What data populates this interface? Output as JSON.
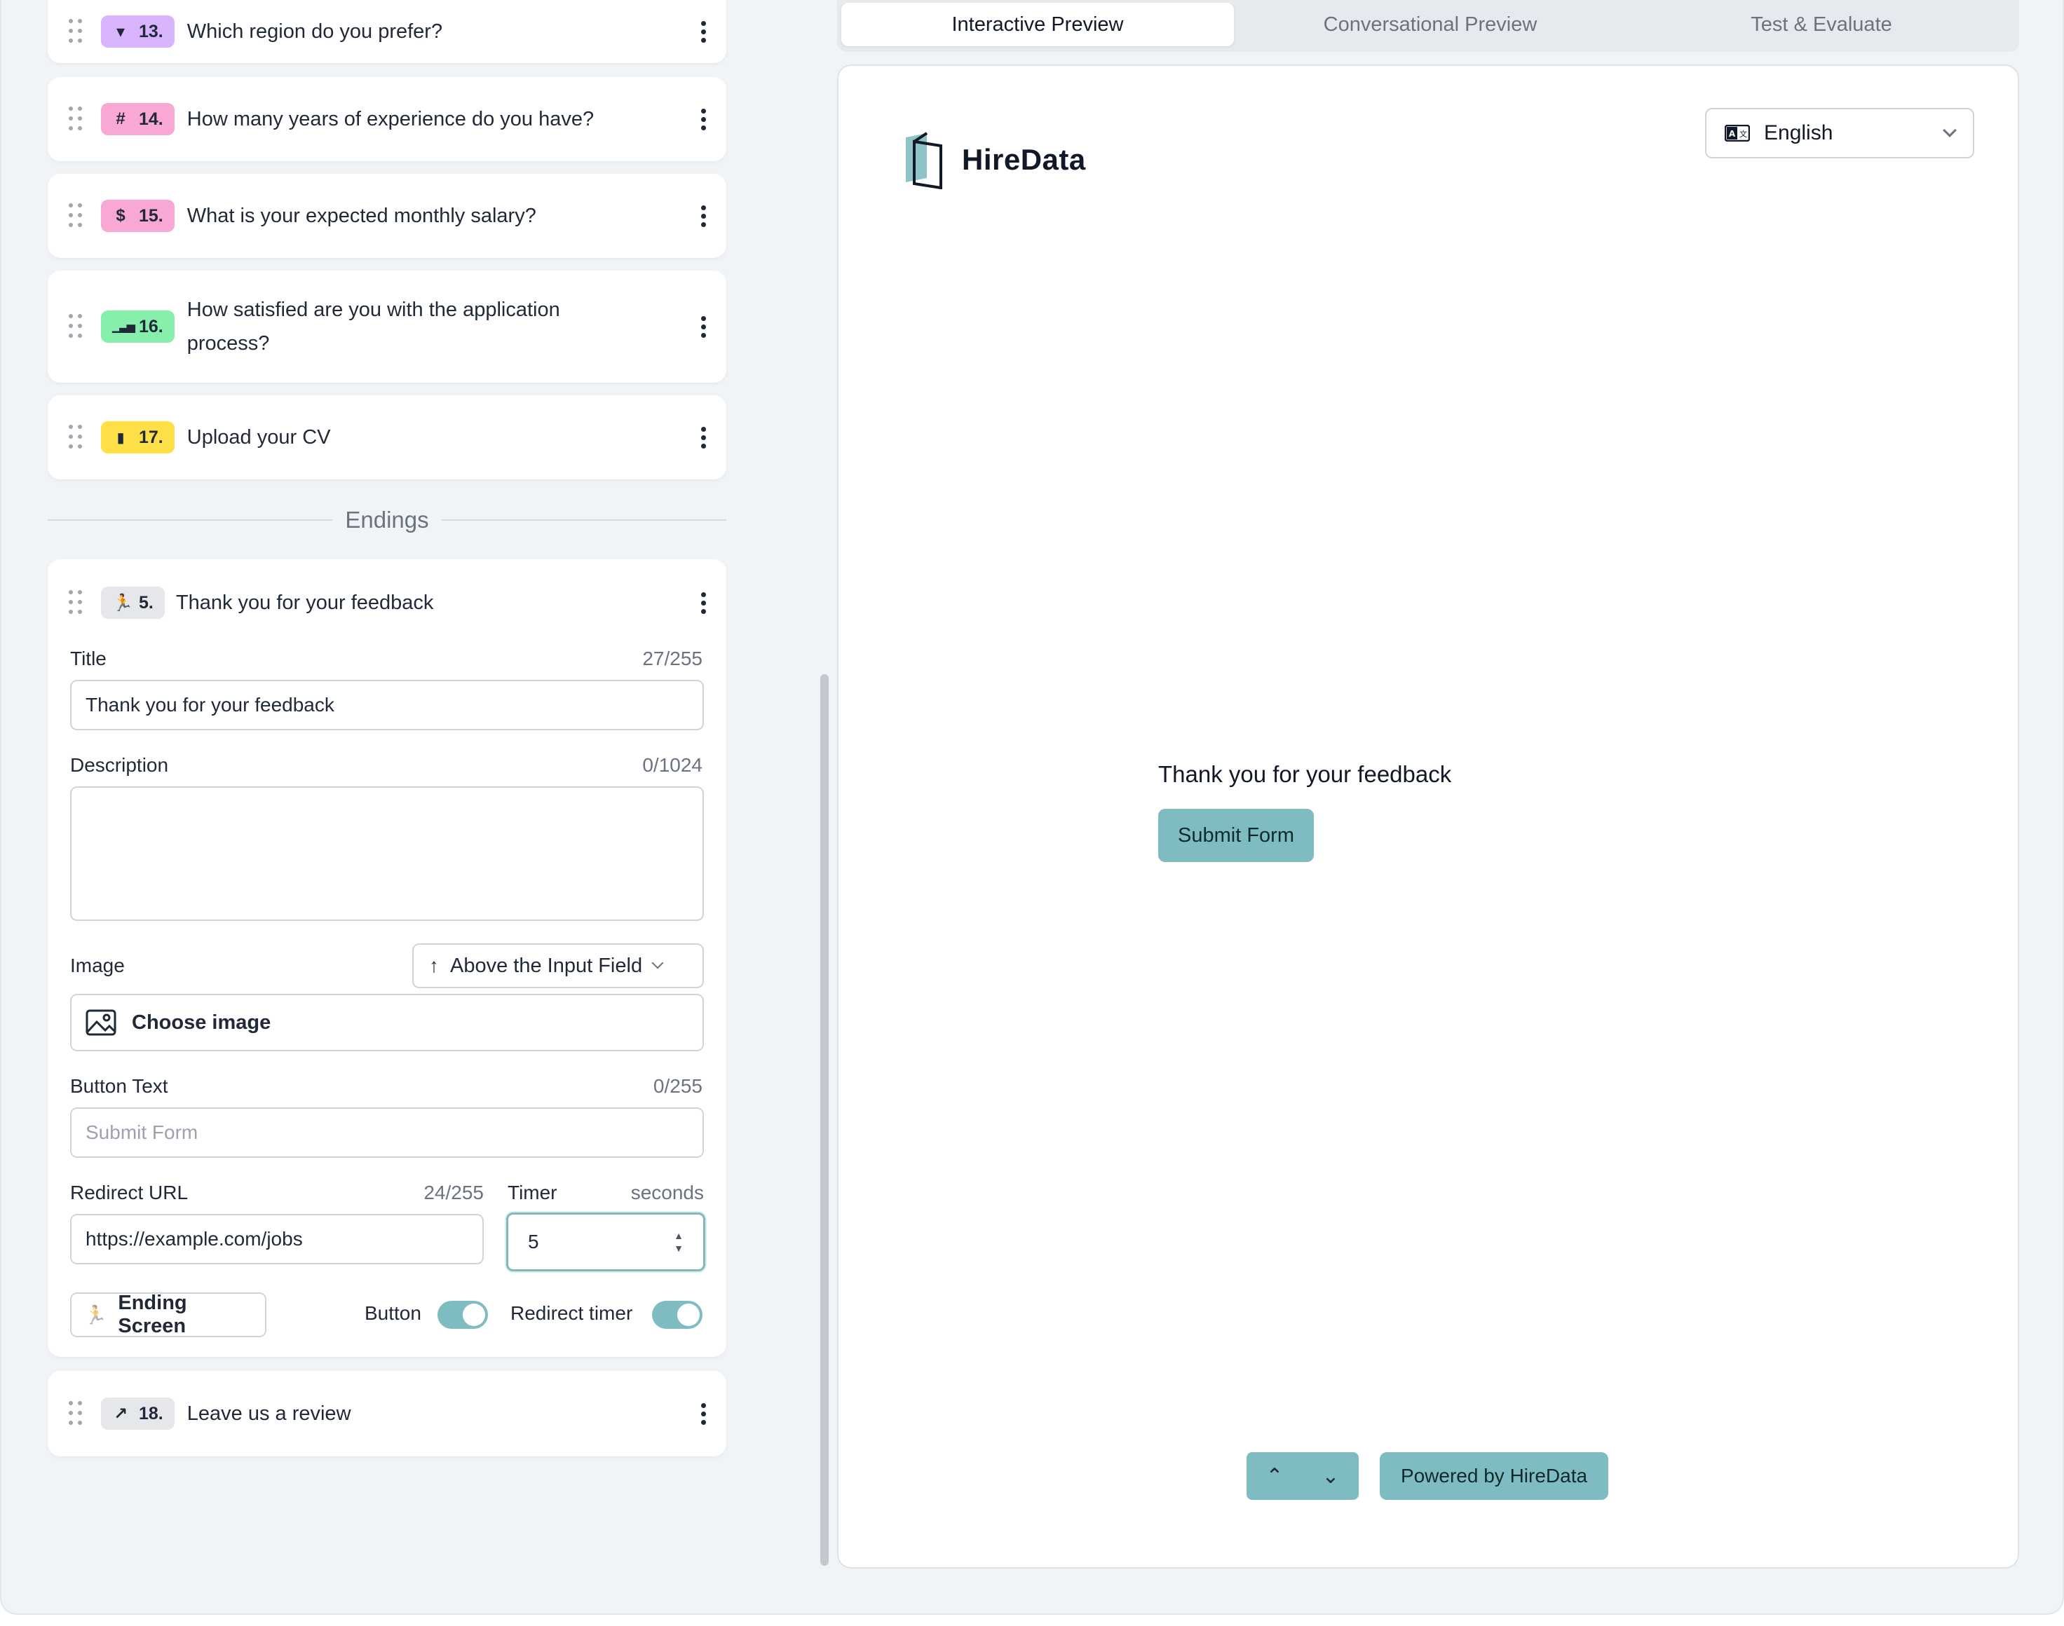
{
  "questions": [
    {
      "number": "13.",
      "text": "Which region do you prefer?",
      "icon": "dropdown-icon",
      "glyph": "▾",
      "color": "#d8b4fe"
    },
    {
      "number": "14.",
      "text": "How many years of experience do you have?",
      "icon": "hash-icon",
      "glyph": "#",
      "color": "#f9a8d4"
    },
    {
      "number": "15.",
      "text": "What is your expected monthly salary?",
      "icon": "dollar-icon",
      "glyph": "$",
      "color": "#f9a8d4"
    },
    {
      "number": "16.",
      "text": "How satisfied are you with the application process?",
      "icon": "rating-bars-icon",
      "glyph": "▁▃▅",
      "color": "#86efac"
    },
    {
      "number": "17.",
      "text": "Upload your CV",
      "icon": "file-icon",
      "glyph": "▮",
      "color": "#fde047"
    }
  ],
  "endings_label": "Endings",
  "ending_card": {
    "number": "5.",
    "header_text": "Thank you for your feedback",
    "icon": "ending-runner-icon",
    "badge_color": "#e5e7eb",
    "title_label": "Title",
    "title_counter": "27/255",
    "title_value": "Thank you for your feedback",
    "description_label": "Description",
    "description_counter": "0/1024",
    "image_label": "Image",
    "image_position": "Above the Input Field",
    "choose_image": "Choose image",
    "button_text_label": "Button Text",
    "button_text_counter": "0/255",
    "button_text_placeholder": "Submit Form",
    "redirect_label": "Redirect URL",
    "redirect_counter": "24/255",
    "redirect_value": "https://example.com/jobs",
    "timer_label": "Timer",
    "timer_unit": "seconds",
    "timer_value": "5",
    "ending_screen_label": "Ending Screen",
    "button_toggle_label": "Button",
    "button_toggle_on": true,
    "redirect_toggle_label": "Redirect timer",
    "redirect_toggle_on": true
  },
  "last_question": {
    "number": "18.",
    "text": "Leave us a review",
    "icon": "external-link-icon",
    "glyph": "↗",
    "color": "#e5e7eb"
  },
  "tabs": [
    "Interactive Preview",
    "Conversational Preview",
    "Test & Evaluate"
  ],
  "active_tab": "Interactive Preview",
  "preview": {
    "brand": "HireData",
    "language": "English",
    "ending_title": "Thank you for your feedback",
    "submit_label": "Submit Form",
    "powered_by": "Powered by HireData",
    "accent": "#7fbcc1"
  }
}
